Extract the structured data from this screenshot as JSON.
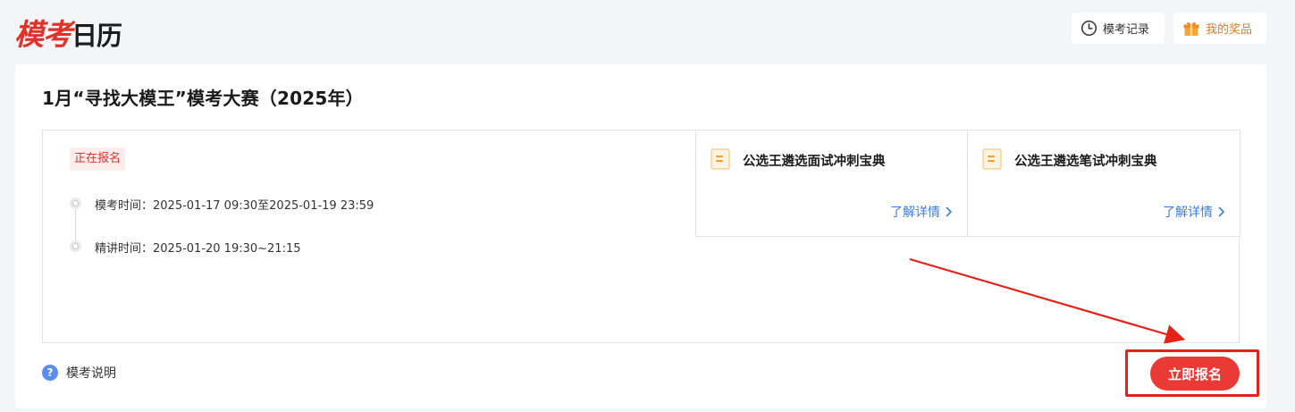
{
  "header": {
    "logo_red": "模考",
    "logo_dark": "日历",
    "record_label": "模考记录",
    "prize_label": "我的奖品"
  },
  "exam": {
    "title": "1月“寻找大模王”模考大赛（2025年）",
    "status": "正在报名",
    "timeline": [
      {
        "label": "模考时间：2025-01-17 09:30至2025-01-19 23:59"
      },
      {
        "label": "精讲时间：2025-01-20 19:30~21:15"
      }
    ],
    "books": [
      {
        "title": "公选王遴选面试冲刺宝典",
        "link": "了解详情"
      },
      {
        "title": "公选王遴选笔试冲刺宝典",
        "link": "了解详情"
      }
    ],
    "help_label": "模考说明",
    "signup_label": "立即报名"
  },
  "colors": {
    "brand_red": "#e0322b",
    "button_red": "#ea3a35",
    "link_blue": "#3d7dd6",
    "prize_orange": "#e07b1b",
    "book_icon_orange": "#f3a23a",
    "annotation_red": "#e2231a"
  }
}
